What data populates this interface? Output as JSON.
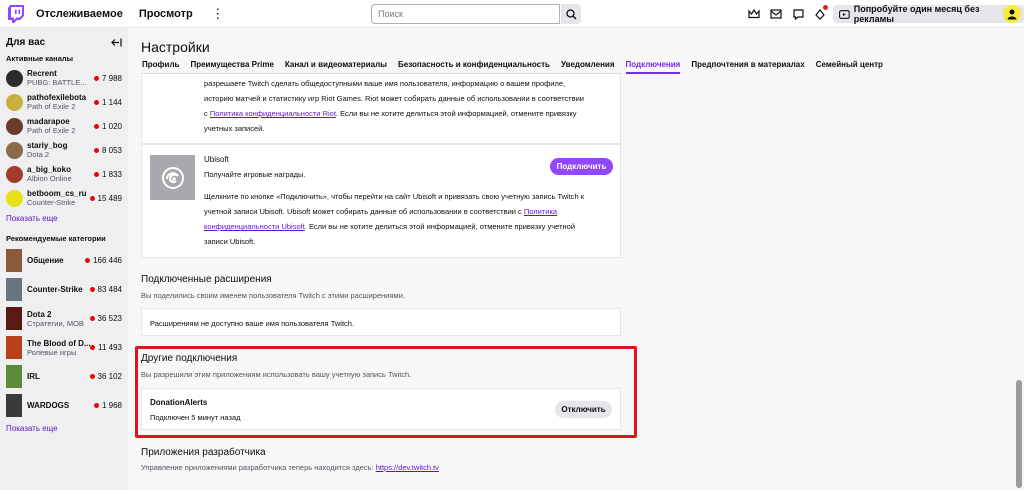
{
  "topbar": {
    "nav": [
      "Отслеживаемое",
      "Просмотр"
    ],
    "search_placeholder": "Поиск",
    "ad_button": "Попробуйте один месяц без рекламы"
  },
  "sidebar": {
    "title": "Для вас",
    "active_title": "Активные каналы",
    "channels": [
      {
        "name": "Recrent",
        "game": "PUBG: BATTLE...",
        "viewers": "7 988",
        "color": "#2b2b2b"
      },
      {
        "name": "pathofexilebota",
        "game": "Path of Exile 2",
        "viewers": "1 144",
        "color": "#c8b13a"
      },
      {
        "name": "madarapoe",
        "game": "Path of Exile 2",
        "viewers": "1 020",
        "color": "#6b3a2a"
      },
      {
        "name": "stariy_bog",
        "game": "Dota 2",
        "viewers": "8 053",
        "color": "#8a6b4a"
      },
      {
        "name": "a_big_koko",
        "game": "Albion Online",
        "viewers": "1 833",
        "color": "#a33a2a"
      },
      {
        "name": "betboom_cs_ru",
        "game": "Counter-Strike",
        "viewers": "15 489",
        "color": "#e8e01a"
      }
    ],
    "show_more": "Показать еще",
    "categories_title": "Рекомендуемые категории",
    "categories": [
      {
        "name": "Общение",
        "sub": "",
        "viewers": "166 446",
        "color": "#8a5a3a"
      },
      {
        "name": "Counter-Strike",
        "sub": "",
        "viewers": "83 484",
        "color": "#6a7480"
      },
      {
        "name": "Dota 2",
        "sub": "Стратегии, MOB",
        "viewers": "36 523",
        "color": "#5a1a14"
      },
      {
        "name": "The Blood of D...",
        "sub": "Ролевые игры",
        "viewers": "11 493",
        "color": "#b8401a"
      },
      {
        "name": "IRL",
        "sub": "",
        "viewers": "36 102",
        "color": "#5a8a3a"
      },
      {
        "name": "WARDOGS",
        "sub": "",
        "viewers": "1 968",
        "color": "#3a3a3a"
      }
    ],
    "show_more_2": "Показать еще"
  },
  "main": {
    "title": "Настройки",
    "tabs": [
      "Профиль",
      "Преимущества Prime",
      "Канал и видеоматериалы",
      "Безопасность и конфиденциальность",
      "Уведомления",
      "Подключения",
      "Предпочтения в материалах",
      "Семейный центр"
    ],
    "riot": {
      "line1": "разрешаете Twitch сделать общедоступными ваше имя пользователя, информацию о вашем профиле,",
      "line2": "историю матчей и статистику игр Riot Games. Riot может собирать данные об использовании в соответствии",
      "line3_pre": "с ",
      "line3_link": "Политика конфиденциальности Riot",
      "line3_post": ". Если вы не хотите делиться этой информацией, отмените привязку",
      "line4": "учетных записей."
    },
    "ubisoft": {
      "name": "Ubisoft",
      "desc": "Получайте игровые награды.",
      "connect": "Подключить",
      "p1": "Щелкните по кнопке «Подключить», чтобы перейти на сайт Ubisoft и привязать свою учетную запись Twitch к",
      "p2_pre": "учетной записи Ubisoft. Ubisoft может собирать данные об использовании в соответствии с ",
      "p2_link": "Политика",
      "p3_link": "конфиденциальности Ubisoft",
      "p3_post": ". Если вы не хотите делиться этой информацией, отмените привязку учетной",
      "p4": "записи Ubisoft."
    },
    "extensions": {
      "title": "Подключенные расширения",
      "desc": "Вы поделились своим именем пользователя Twitch с этими расширениями.",
      "empty": "Расширениям не доступно ваше имя пользователя Twitch."
    },
    "other": {
      "title": "Другие подключения",
      "desc": "Вы разрешили этим приложениям использовать вашу учетную запись Twitch.",
      "app_name": "DonationAlerts",
      "app_status": "Подключен 5 минут назад",
      "disconnect": "Отключить"
    },
    "dev": {
      "title": "Приложения разработчика",
      "desc_pre": "Управление приложениями разработчика теперь находится здесь: ",
      "link": "https://dev.twitch.tv"
    }
  },
  "colors": {
    "accent": "#9147ff",
    "highlight_box": "#e0141c",
    "live": "#eb0400"
  }
}
